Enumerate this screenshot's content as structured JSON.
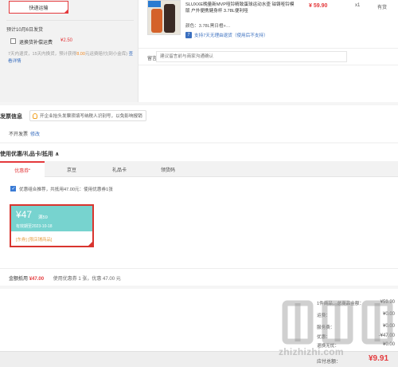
{
  "shipping": {
    "method_label": "快递运输",
    "date_text": "预计10月6日发货",
    "insurance": {
      "checked": false,
      "label": "退换货补偿运费",
      "price": "¥2.50",
      "desc_prefix": "7天内退货，15天内换货，预计获得",
      "desc_amount": "8.00",
      "desc_suffix": "元运费赔付(到小金库)",
      "details_link": "查看详情"
    }
  },
  "product": {
    "title": "SLUXXE晚量新MVP哑铃精致蛋球运动水壶 铂铸哑铃模版 户外便携健身杯 3.78L便利哑",
    "spec": "颜色：3.78L黑日橙+…",
    "return_badge": "7",
    "return_policy": "支持7天无理由退货（使用后不支持）",
    "price": "¥ 59.90",
    "quantity": "x1",
    "stock": "有货"
  },
  "remark": {
    "label": "留言:",
    "placeholder": "建议留言前与商家沟通确认"
  },
  "invoice": {
    "title": "发票信息",
    "tip": "开企业抬头发票须填写纳税人识别号，以免影响报销",
    "value": "不开发票",
    "edit_link": "修改"
  },
  "coupons": {
    "title": "使用优惠/礼品卡/抵用 ∧",
    "tabs": [
      {
        "label": "优惠券",
        "badge": "•",
        "active": true
      },
      {
        "label": "京豆",
        "active": false
      },
      {
        "label": "礼品卡",
        "active": false
      },
      {
        "label": "领货码",
        "active": false
      }
    ],
    "recommend_checked": true,
    "recommend_text": "优惠组合推荐，共抵用47.00元：使用优惠券1张",
    "card": {
      "amount": "¥47",
      "condition": "满59",
      "expiry": "有效期至2023-10-18",
      "scope": "[东券]   [限店铺商品]"
    },
    "deduct_label": "金额抵用",
    "deduct_amount": "¥47.00",
    "used_text": "使用优惠券 1 张，优惠 47.00 元"
  },
  "summary": {
    "rows": [
      {
        "label": "1件商品，总商品金额：",
        "value": "¥59.90"
      },
      {
        "label": "运费：",
        "value": "¥0.00"
      },
      {
        "label": "服务费：",
        "value": "¥0.00"
      },
      {
        "label": "优惠：",
        "value": "-¥47.00"
      },
      {
        "label": "退换无忧：",
        "value": "¥0.00"
      }
    ],
    "payable_label": "应付总额：",
    "payable_value": "¥9.91"
  },
  "watermark": {
    "domain": "zhizhizhi.com"
  },
  "colors": {
    "accent_red": "#e4393c",
    "coupon_teal": "#77d3cf",
    "link_blue": "#3a6fbf"
  }
}
